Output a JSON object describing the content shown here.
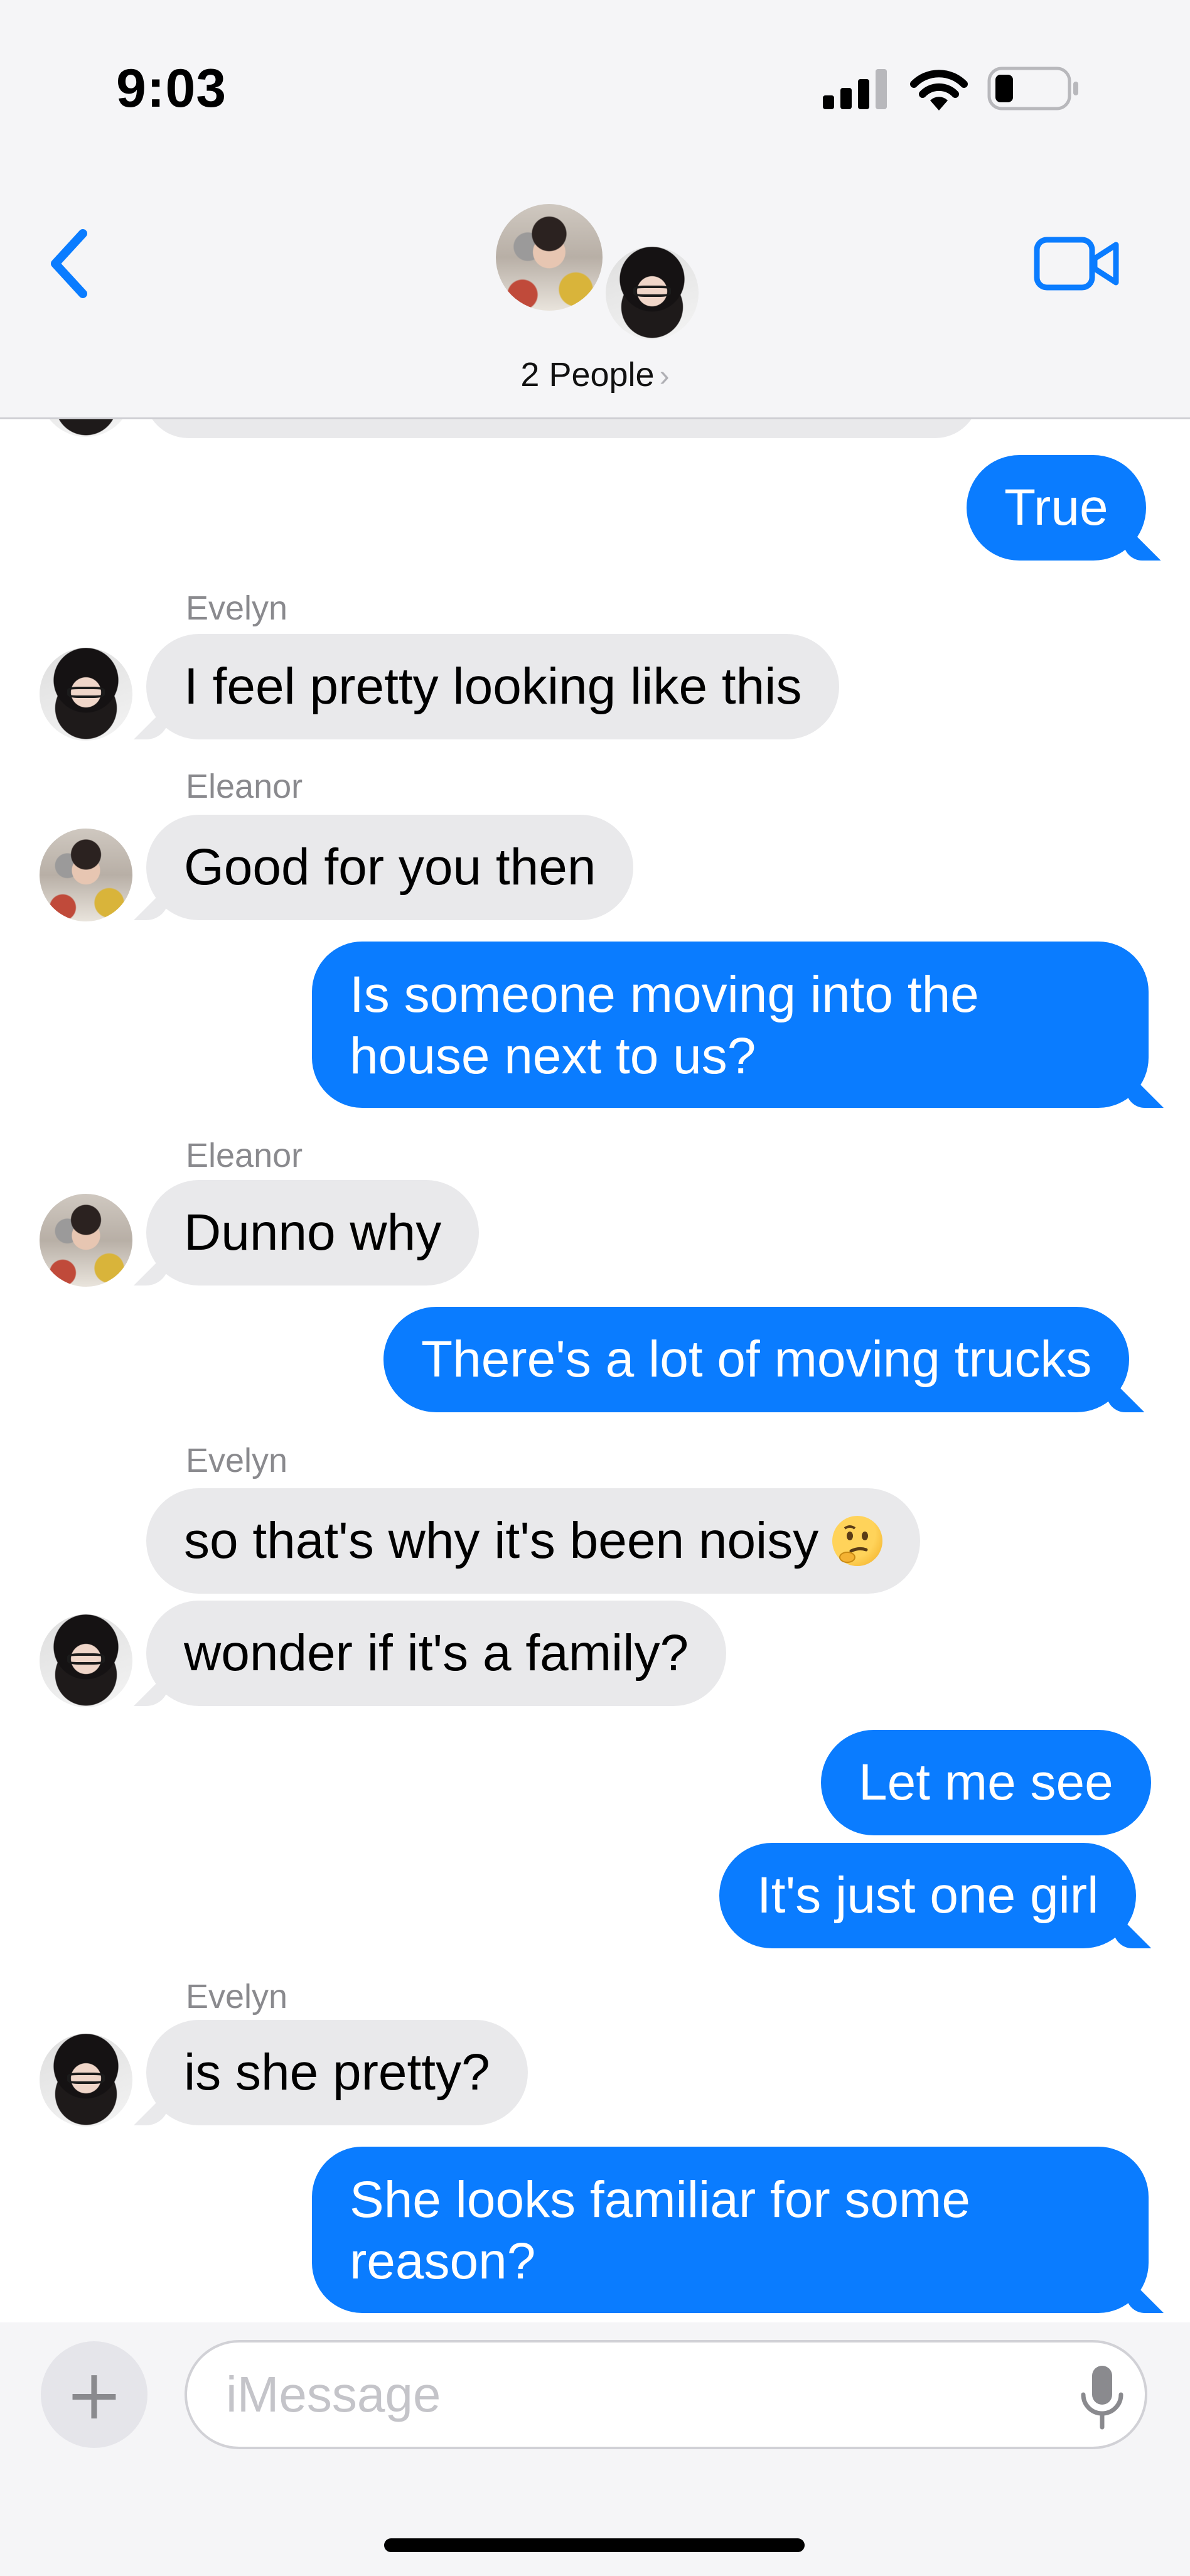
{
  "status_bar": {
    "time": "9:03"
  },
  "header": {
    "people_label": "2 People",
    "chevron": "›"
  },
  "colors": {
    "accent": "#0a7cff",
    "incoming_bubble": "#e9e9eb",
    "sender_label": "#8a8a8e"
  },
  "icons": {
    "back": "chevron-left-icon",
    "video": "video-camera-icon",
    "signal": "cellular-signal-icon",
    "wifi": "wifi-icon",
    "battery": "battery-icon",
    "mic": "microphone-icon",
    "plus": "plus-icon"
  },
  "messages": [
    {
      "text": "True"
    },
    {
      "sender": "Evelyn",
      "text": "I feel pretty looking like this"
    },
    {
      "sender": "Eleanor",
      "text": "Good for you then"
    },
    {
      "text": "Is someone moving into the house next to us?"
    },
    {
      "sender": "Eleanor",
      "text": "Dunno why"
    },
    {
      "text": "There's a lot of moving trucks"
    },
    {
      "sender": "Evelyn",
      "text": "so that's why it's been noisy"
    },
    {
      "text": "wonder if it's a family?"
    },
    {
      "text": "Let me see"
    },
    {
      "text": "It's just one girl"
    },
    {
      "sender": "Evelyn",
      "text": "is she pretty?"
    },
    {
      "text": "She looks familiar for some reason?"
    }
  ],
  "composer": {
    "placeholder": "iMessage",
    "plus": "+"
  }
}
